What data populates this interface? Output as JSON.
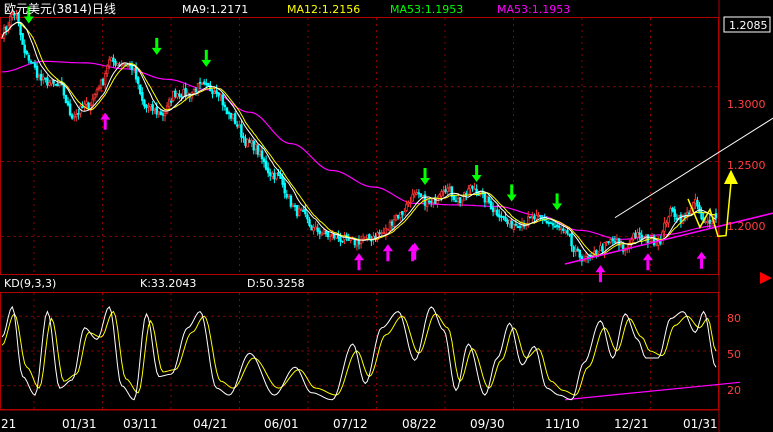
{
  "header": {
    "title": "欧元美元(3814)日线",
    "ma": [
      {
        "label": "MA9:1.2171",
        "color": "#ffffff"
      },
      {
        "label": "MA12:1.2156",
        "color": "#ffff00"
      },
      {
        "label": "MA53:1.1953",
        "color": "#00ff00"
      },
      {
        "label": "MA53:1.1953",
        "color": "#ff00ff"
      }
    ]
  },
  "kd_header": {
    "label": "KD(9,3,3)",
    "k": "K:33.2043",
    "d": "D:50.3258"
  },
  "price_axis": {
    "current": "1.2085",
    "ticks": [
      "1.3000",
      "1.2500",
      "1.2000"
    ]
  },
  "kd_axis": {
    "ticks": [
      "80",
      "50",
      "20"
    ]
  },
  "x_ticks": [
    "21",
    "01/31",
    "03/11",
    "04/21",
    "06/01",
    "07/12",
    "08/22",
    "09/30",
    "11/10",
    "12/21",
    "01/31"
  ],
  "colors": {
    "bg": "#000000",
    "up": "#ff3333",
    "down": "#00ffff",
    "ma9": "#ffffff",
    "ma12": "#ffff00",
    "ma53": "#ff00ff",
    "grid": "#8b0000",
    "axis": "#b00000",
    "sell_arrow": "#00ff00",
    "buy_arrow": "#ff00ff",
    "forecast": "#ffff00"
  },
  "chart_data": [
    {
      "type": "candlestick",
      "title": "欧元美元(3814)日线",
      "ylim": [
        1.1748,
        1.346
      ],
      "series": [
        {
          "name": "close",
          "anchors": [
            [
              0,
              1.336
            ],
            [
              6,
              1.349
            ],
            [
              12,
              1.32
            ],
            [
              20,
              1.304
            ],
            [
              28,
              1.3
            ],
            [
              34,
              1.281
            ],
            [
              42,
              1.288
            ],
            [
              48,
              1.302
            ],
            [
              52,
              1.317
            ],
            [
              58,
              1.316
            ],
            [
              62,
              1.314
            ],
            [
              70,
              1.286
            ],
            [
              78,
              1.282
            ],
            [
              84,
              1.296
            ],
            [
              90,
              1.295
            ],
            [
              96,
              1.3
            ],
            [
              104,
              1.298
            ],
            [
              110,
              1.281
            ],
            [
              120,
              1.262
            ],
            [
              132,
              1.241
            ],
            [
              144,
              1.216
            ],
            [
              152,
              1.204
            ],
            [
              160,
              1.2
            ],
            [
              170,
              1.196
            ],
            [
              176,
              1.198
            ],
            [
              184,
              1.202
            ],
            [
              192,
              1.214
            ],
            [
              200,
              1.227
            ],
            [
              208,
              1.222
            ],
            [
              214,
              1.233
            ],
            [
              222,
              1.224
            ],
            [
              228,
              1.233
            ],
            [
              234,
              1.225
            ],
            [
              240,
              1.216
            ],
            [
              246,
              1.208
            ],
            [
              252,
              1.209
            ],
            [
              258,
              1.212
            ],
            [
              264,
              1.21
            ],
            [
              270,
              1.205
            ],
            [
              274,
              1.2
            ],
            [
              278,
              1.188
            ],
            [
              284,
              1.184
            ],
            [
              290,
              1.192
            ],
            [
              296,
              1.197
            ],
            [
              302,
              1.191
            ],
            [
              306,
              1.201
            ],
            [
              312,
              1.198
            ],
            [
              318,
              1.197
            ],
            [
              324,
              1.216
            ],
            [
              330,
              1.212
            ],
            [
              336,
              1.222
            ],
            [
              340,
              1.208
            ],
            [
              346,
              1.214
            ]
          ]
        },
        {
          "name": "MA53",
          "anchors": [
            [
              0,
              1.31
            ],
            [
              20,
              1.317
            ],
            [
              40,
              1.316
            ],
            [
              60,
              1.312
            ],
            [
              80,
              1.305
            ],
            [
              100,
              1.298
            ],
            [
              120,
              1.283
            ],
            [
              140,
              1.262
            ],
            [
              160,
              1.244
            ],
            [
              180,
              1.233
            ],
            [
              200,
              1.222
            ],
            [
              220,
              1.221
            ],
            [
              240,
              1.22
            ],
            [
              260,
              1.214
            ],
            [
              280,
              1.204
            ],
            [
              300,
              1.198
            ],
            [
              320,
              1.201
            ],
            [
              346,
              1.207
            ]
          ]
        }
      ]
    },
    {
      "type": "line",
      "ylim": [
        0,
        100
      ],
      "series": [
        {
          "name": "K",
          "anchors": [
            [
              0,
              62
            ],
            [
              5,
              88
            ],
            [
              10,
              28
            ],
            [
              16,
              12
            ],
            [
              22,
              84
            ],
            [
              28,
              18
            ],
            [
              34,
              25
            ],
            [
              40,
              70
            ],
            [
              46,
              60
            ],
            [
              52,
              88
            ],
            [
              58,
              20
            ],
            [
              64,
              8
            ],
            [
              70,
              82
            ],
            [
              76,
              28
            ],
            [
              82,
              30
            ],
            [
              90,
              70
            ],
            [
              96,
              84
            ],
            [
              104,
              18
            ],
            [
              110,
              12
            ],
            [
              120,
              48
            ],
            [
              132,
              12
            ],
            [
              142,
              36
            ],
            [
              150,
              14
            ],
            [
              160,
              8
            ],
            [
              170,
              56
            ],
            [
              176,
              22
            ],
            [
              184,
              70
            ],
            [
              192,
              84
            ],
            [
              200,
              42
            ],
            [
              208,
              88
            ],
            [
              214,
              68
            ],
            [
              220,
              16
            ],
            [
              226,
              56
            ],
            [
              234,
              12
            ],
            [
              240,
              44
            ],
            [
              246,
              74
            ],
            [
              252,
              38
            ],
            [
              258,
              54
            ],
            [
              264,
              18
            ],
            [
              270,
              12
            ],
            [
              276,
              8
            ],
            [
              282,
              40
            ],
            [
              290,
              76
            ],
            [
              296,
              44
            ],
            [
              302,
              82
            ],
            [
              308,
              60
            ],
            [
              312,
              44
            ],
            [
              318,
              44
            ],
            [
              324,
              78
            ],
            [
              330,
              84
            ],
            [
              336,
              66
            ],
            [
              340,
              84
            ],
            [
              346,
              36
            ]
          ]
        },
        {
          "name": "D",
          "anchors": [
            [
              0,
              55
            ],
            [
              6,
              82
            ],
            [
              12,
              36
            ],
            [
              18,
              18
            ],
            [
              24,
              78
            ],
            [
              30,
              24
            ],
            [
              36,
              30
            ],
            [
              42,
              66
            ],
            [
              48,
              62
            ],
            [
              54,
              84
            ],
            [
              60,
              26
            ],
            [
              66,
              14
            ],
            [
              72,
              76
            ],
            [
              78,
              32
            ],
            [
              84,
              34
            ],
            [
              92,
              66
            ],
            [
              98,
              80
            ],
            [
              106,
              24
            ],
            [
              112,
              18
            ],
            [
              122,
              44
            ],
            [
              134,
              18
            ],
            [
              144,
              34
            ],
            [
              152,
              18
            ],
            [
              162,
              12
            ],
            [
              172,
              50
            ],
            [
              178,
              28
            ],
            [
              186,
              64
            ],
            [
              194,
              80
            ],
            [
              202,
              48
            ],
            [
              210,
              82
            ],
            [
              216,
              70
            ],
            [
              222,
              24
            ],
            [
              228,
              52
            ],
            [
              236,
              18
            ],
            [
              242,
              42
            ],
            [
              248,
              70
            ],
            [
              254,
              44
            ],
            [
              260,
              52
            ],
            [
              266,
              24
            ],
            [
              272,
              16
            ],
            [
              278,
              12
            ],
            [
              284,
              36
            ],
            [
              292,
              70
            ],
            [
              298,
              50
            ],
            [
              304,
              78
            ],
            [
              310,
              62
            ],
            [
              314,
              50
            ],
            [
              320,
              46
            ],
            [
              326,
              72
            ],
            [
              332,
              80
            ],
            [
              338,
              70
            ],
            [
              342,
              78
            ],
            [
              346,
              50
            ]
          ]
        }
      ]
    }
  ]
}
